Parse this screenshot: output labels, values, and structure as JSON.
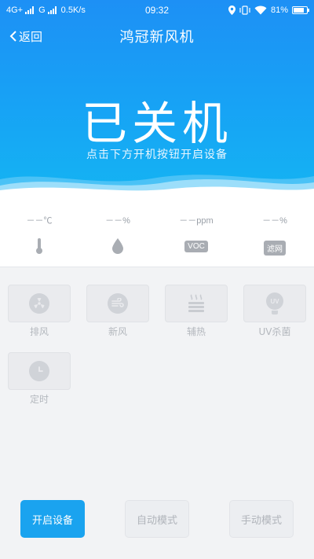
{
  "status_bar": {
    "network_1": "4G+",
    "network_2": "G",
    "speed": "0.5K/s",
    "time": "09:32",
    "battery": "81%"
  },
  "nav": {
    "back_label": "返回",
    "title": "鸿冠新风机"
  },
  "hero": {
    "state": "已关机",
    "hint": "点击下方开机按钮开启设备"
  },
  "readings": [
    {
      "value": "－－℃",
      "icon": "thermometer-icon"
    },
    {
      "value": "－－%",
      "icon": "water-drop-icon"
    },
    {
      "value": "－－ppm",
      "icon": "voc-icon",
      "tag": "VOC"
    },
    {
      "value": "－－%",
      "icon": "filter-icon",
      "tag": "滤网"
    }
  ],
  "functions": [
    {
      "label": "排风",
      "icon": "exhaust-fan-icon"
    },
    {
      "label": "新风",
      "icon": "fresh-air-icon"
    },
    {
      "label": "辅热",
      "icon": "heater-icon"
    },
    {
      "label": "UV杀菌",
      "icon": "uv-lamp-icon",
      "icon_text": "UV"
    },
    {
      "label": "定时",
      "icon": "clock-icon"
    }
  ],
  "buttons": {
    "power_on": "开启设备",
    "auto_mode": "自动模式",
    "manual_mode": "手动模式"
  },
  "colors": {
    "primary": "#1aa3ef",
    "header_top": "#1d90f5",
    "disabled_text": "#b4b8be"
  }
}
